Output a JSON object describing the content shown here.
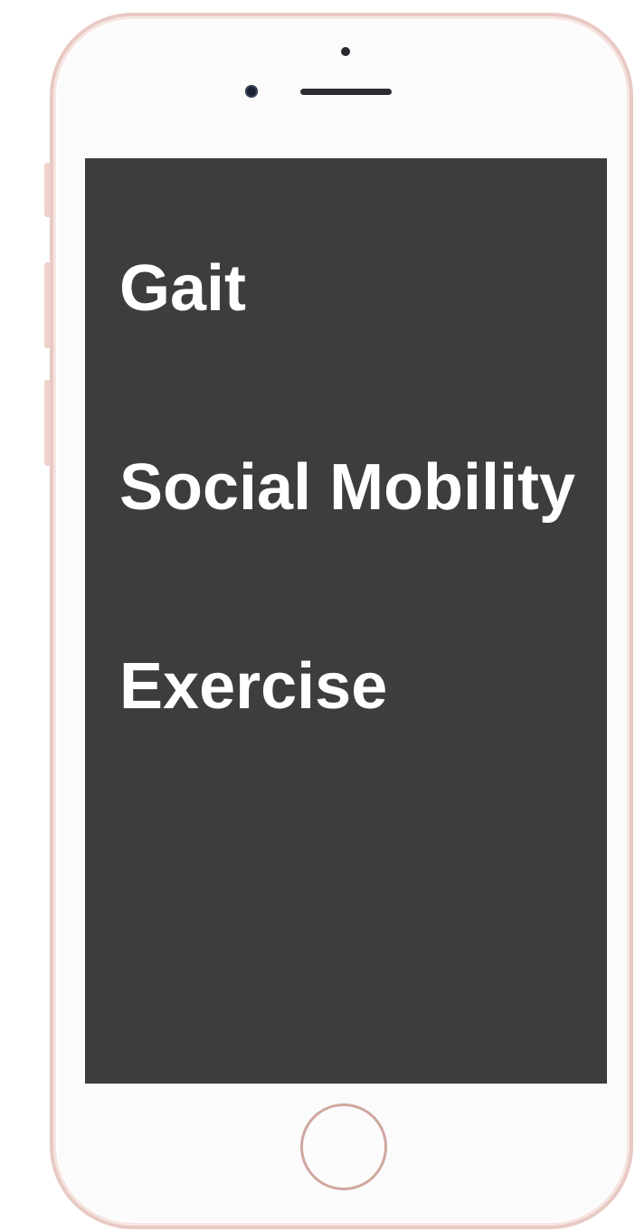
{
  "menu": {
    "items": [
      {
        "label": "Gait"
      },
      {
        "label": "Social Mobility"
      },
      {
        "label": "Exercise"
      }
    ]
  },
  "colors": {
    "screen_background": "#3d3d3f",
    "text": "#ffffff",
    "phone_frame": "#e9c9c3",
    "phone_body": "#fbfbfc"
  },
  "icons": {
    "home_button": "home-button-icon",
    "camera": "front-camera-icon",
    "speaker": "earpiece-speaker-icon",
    "sensor": "proximity-sensor-icon"
  }
}
